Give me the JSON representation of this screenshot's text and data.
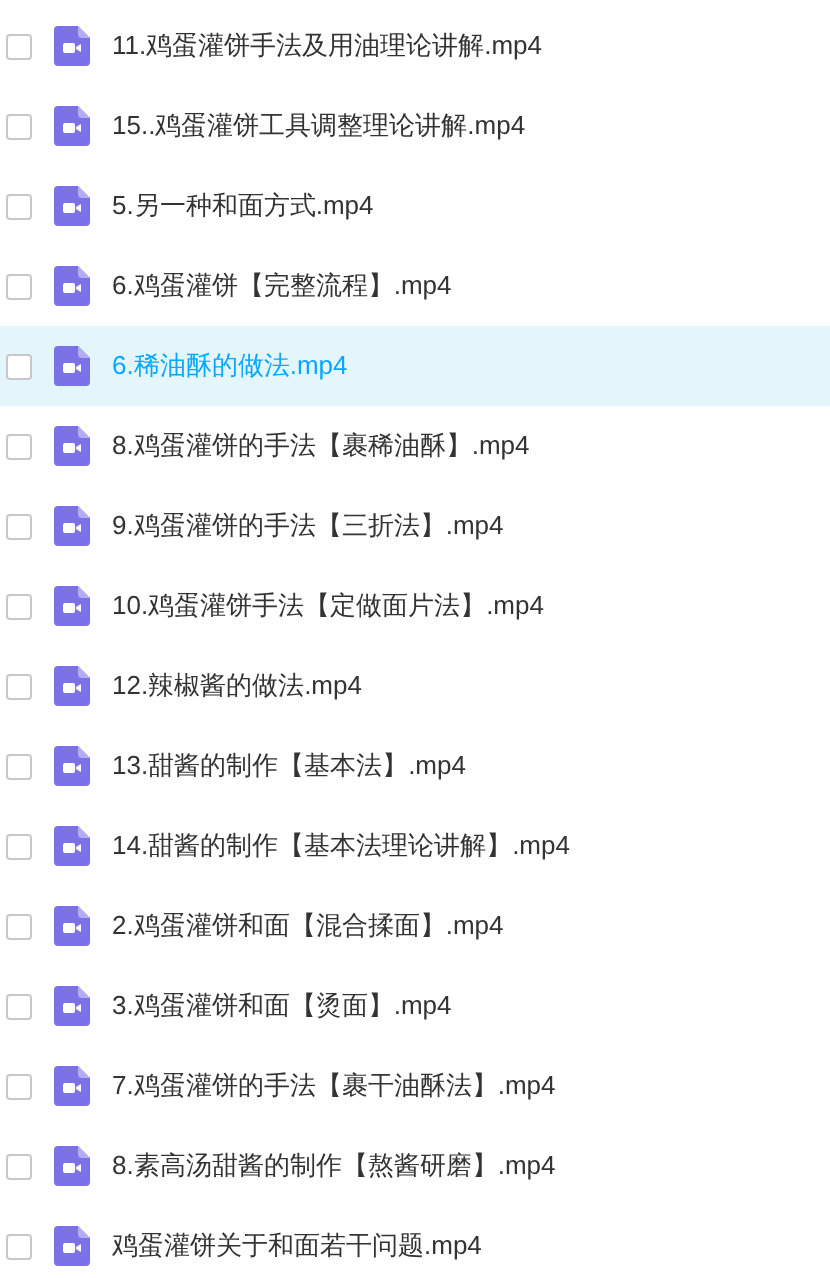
{
  "files": [
    {
      "name": "11.鸡蛋灌饼手法及用油理论讲解.mp4",
      "checked": false,
      "selected": false
    },
    {
      "name": "15..鸡蛋灌饼工具调整理论讲解.mp4",
      "checked": false,
      "selected": false
    },
    {
      "name": "5.另一种和面方式.mp4",
      "checked": false,
      "selected": false
    },
    {
      "name": "6.鸡蛋灌饼【完整流程】.mp4",
      "checked": false,
      "selected": false
    },
    {
      "name": "6.稀油酥的做法.mp4",
      "checked": false,
      "selected": true
    },
    {
      "name": "8.鸡蛋灌饼的手法【裹稀油酥】.mp4",
      "checked": false,
      "selected": false
    },
    {
      "name": "9.鸡蛋灌饼的手法【三折法】.mp4",
      "checked": false,
      "selected": false
    },
    {
      "name": "10.鸡蛋灌饼手法【定做面片法】.mp4",
      "checked": false,
      "selected": false
    },
    {
      "name": "12.辣椒酱的做法.mp4",
      "checked": false,
      "selected": false
    },
    {
      "name": "13.甜酱的制作【基本法】.mp4",
      "checked": false,
      "selected": false
    },
    {
      "name": "14.甜酱的制作【基本法理论讲解】.mp4",
      "checked": false,
      "selected": false
    },
    {
      "name": "2.鸡蛋灌饼和面【混合揉面】.mp4",
      "checked": false,
      "selected": false
    },
    {
      "name": "3.鸡蛋灌饼和面【烫面】.mp4",
      "checked": false,
      "selected": false
    },
    {
      "name": "7.鸡蛋灌饼的手法【裹干油酥法】.mp4",
      "checked": false,
      "selected": false
    },
    {
      "name": "8.素高汤甜酱的制作【熬酱研磨】.mp4",
      "checked": false,
      "selected": false
    },
    {
      "name": "鸡蛋灌饼关于和面若干问题.mp4",
      "checked": false,
      "selected": false
    }
  ]
}
